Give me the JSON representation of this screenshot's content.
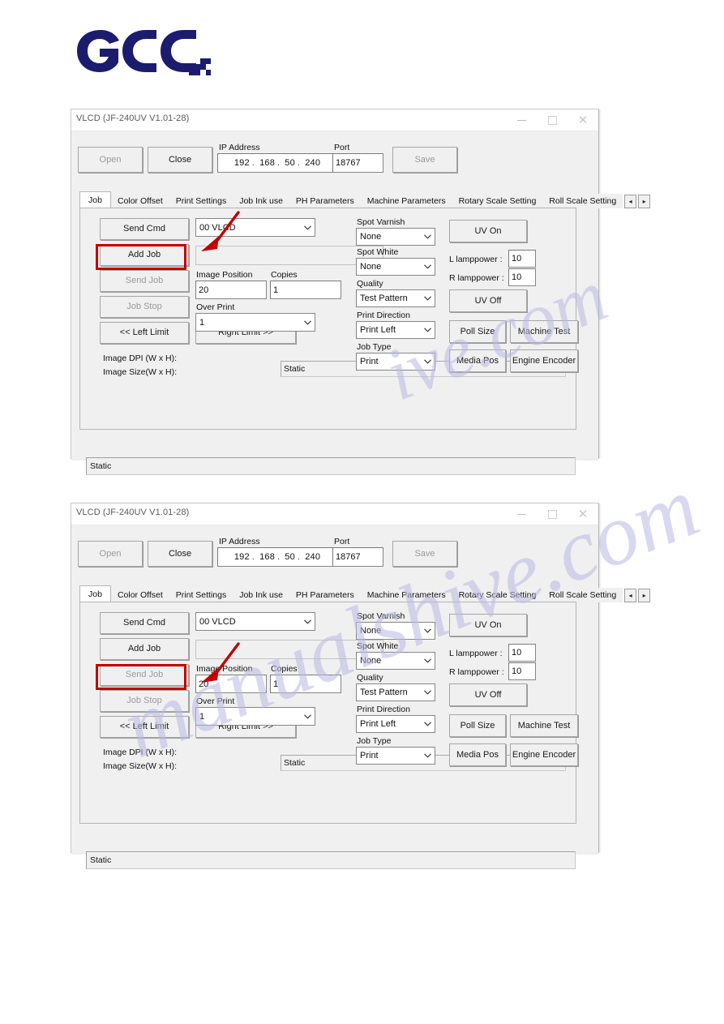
{
  "page": {
    "logo_alt": "GCC",
    "watermark_line1": "ive.com",
    "watermark_line2": "manualshive.com"
  },
  "window": {
    "title": "VLCD (JF-240UV V1.01-28)",
    "controls": {
      "minimize": "minimize-icon",
      "maximize": "maximize-icon",
      "close": "close-icon"
    },
    "toolbar": {
      "open_label": "Open",
      "close_label": "Close",
      "ip_label": "IP Address",
      "ip_octets": [
        "192",
        "168",
        "50",
        "240"
      ],
      "ip_separator": ".",
      "port_label": "Port",
      "port_value": "18767",
      "save_label": "Save"
    },
    "tabs": [
      {
        "label": "Job",
        "active": true
      },
      {
        "label": "Color Offset",
        "active": false
      },
      {
        "label": "Print Settings",
        "active": false
      },
      {
        "label": "Job Ink use",
        "active": false
      },
      {
        "label": "PH Parameters",
        "active": false
      },
      {
        "label": "Machine Parameters",
        "active": false
      },
      {
        "label": "Rotary Scale Setting",
        "active": false
      },
      {
        "label": "Roll Scale Setting",
        "active": false
      }
    ],
    "tab_scroll": {
      "prev": "◂",
      "next": "▸"
    },
    "job_panel": {
      "send_cmd_label": "Send Cmd",
      "add_job_label": "Add Job",
      "send_job_label": "Send Job",
      "job_stop_label": "Job Stop",
      "left_limit_label": "<< Left Limit",
      "right_limit_label": "Right Limit >>",
      "cmd_combo_value": "00 VLCD",
      "job_file_value": "",
      "image_position_label": "Image Position",
      "image_position_value": "20",
      "copies_label": "Copies",
      "copies_value": "1",
      "over_print_label": "Over Print",
      "over_print_value": "1",
      "image_dpi_label": "Image DPI (W x H):",
      "image_size_label": "Image Size(W x H):",
      "info_static_value": "Static"
    },
    "right_panel": {
      "spot_varnish_label": "Spot Varnish",
      "spot_varnish_value": "None",
      "spot_white_label": "Spot White",
      "spot_white_value": "None",
      "quality_label": "Quality",
      "quality_value": "Test Pattern",
      "print_direction_label": "Print Direction",
      "print_direction_value": "Print Left",
      "job_type_label": "Job Type",
      "job_type_value": "Print",
      "uv_on_label": "UV On",
      "uv_off_label": "UV Off",
      "l_lamppower_label": "L lamppower :",
      "l_lamppower_value": "10",
      "r_lamppower_label": "R lamppower :",
      "r_lamppower_value": "10",
      "poll_size_label": "Poll Size",
      "machine_test_label": "Machine Test",
      "media_pos_label": "Media Pos",
      "engine_encoder_label": "Engine Encoder"
    },
    "status_bar_value": "Static"
  },
  "annotations": {
    "screenshot_1_highlight": "Add Job",
    "screenshot_2_highlight": "Send Job",
    "highlight_color": "#c00000"
  }
}
